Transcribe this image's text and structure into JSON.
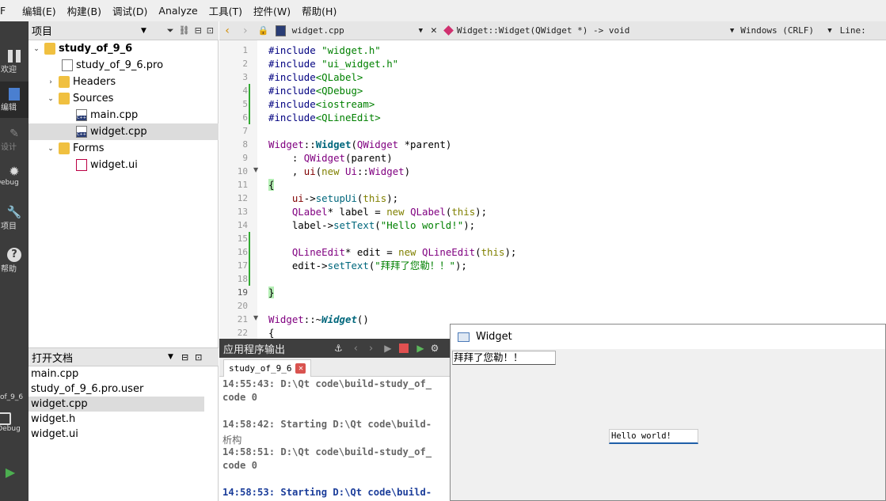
{
  "menu": [
    "编辑(E)",
    "构建(B)",
    "调试(D)",
    "Analyze",
    "工具(T)",
    "控件(W)",
    "帮助(H)"
  ],
  "modebar": {
    "labels": [
      "欢迎",
      "编辑",
      "设计",
      "Debug",
      "项目",
      "帮助"
    ],
    "project_label": "of_9_6",
    "debug_label": "Debug"
  },
  "project_panel": {
    "title": "项目",
    "tree": [
      {
        "label": "study_of_9_6",
        "kind": "project"
      },
      {
        "label": "study_of_9_6.pro",
        "kind": "pro"
      },
      {
        "label": "Headers",
        "kind": "folder"
      },
      {
        "label": "Sources",
        "kind": "folder"
      },
      {
        "label": "main.cpp",
        "kind": "cpp"
      },
      {
        "label": "widget.cpp",
        "kind": "cpp",
        "selected": true
      },
      {
        "label": "Forms",
        "kind": "folder"
      },
      {
        "label": "widget.ui",
        "kind": "ui"
      }
    ]
  },
  "open_docs": {
    "title": "打开文档",
    "items": [
      "main.cpp",
      "study_of_9_6.pro.user",
      "widget.cpp",
      "widget.h",
      "widget.ui"
    ],
    "selected": "widget.cpp"
  },
  "editor_toolbar": {
    "file": "widget.cpp",
    "symbol": "Widget::Widget(QWidget *) -> void",
    "encoding": "Windows (CRLF)",
    "line": "Line:"
  },
  "line_numbers": [
    "1",
    "2",
    "3",
    "4",
    "5",
    "6",
    "7",
    "8",
    "9",
    "10",
    "11",
    "12",
    "13",
    "14",
    "15",
    "16",
    "17",
    "18",
    "19",
    "20",
    "21",
    "22"
  ],
  "code": [
    "#include \"widget.h\"",
    "#include \"ui_widget.h\"",
    "#include<QLabel>",
    "#include<QDebug>",
    "#include<iostream>",
    "#include<QLineEdit>",
    "",
    "Widget::Widget(QWidget *parent)",
    "    : QWidget(parent)",
    "    , ui(new Ui::Widget)",
    "{",
    "    ui->setupUi(this);",
    "    QLabel* label = new QLabel(this);",
    "    label->setText(\"Hello world!\");",
    "",
    "    QLineEdit* edit = new QLineEdit(this);",
    "    edit->setText(\"拜拜了您勒！！\");",
    "",
    "}",
    "",
    "Widget::~Widget()",
    "{"
  ],
  "output_panel": {
    "title": "应用程序输出",
    "tab": "study_of_9_6",
    "lines": [
      "14:55:43: D:\\Qt code\\build-study_of_",
      "code 0",
      "",
      "14:58:42: Starting D:\\Qt code\\build-",
      "析构",
      "14:58:51: D:\\Qt code\\build-study_of_",
      "code 0",
      "",
      "14:58:53: Starting D:\\Qt code\\build-"
    ]
  },
  "widget_window": {
    "title": "Widget",
    "line_edit_text": "拜拜了您勒！！",
    "label_text": "Hello world!"
  }
}
